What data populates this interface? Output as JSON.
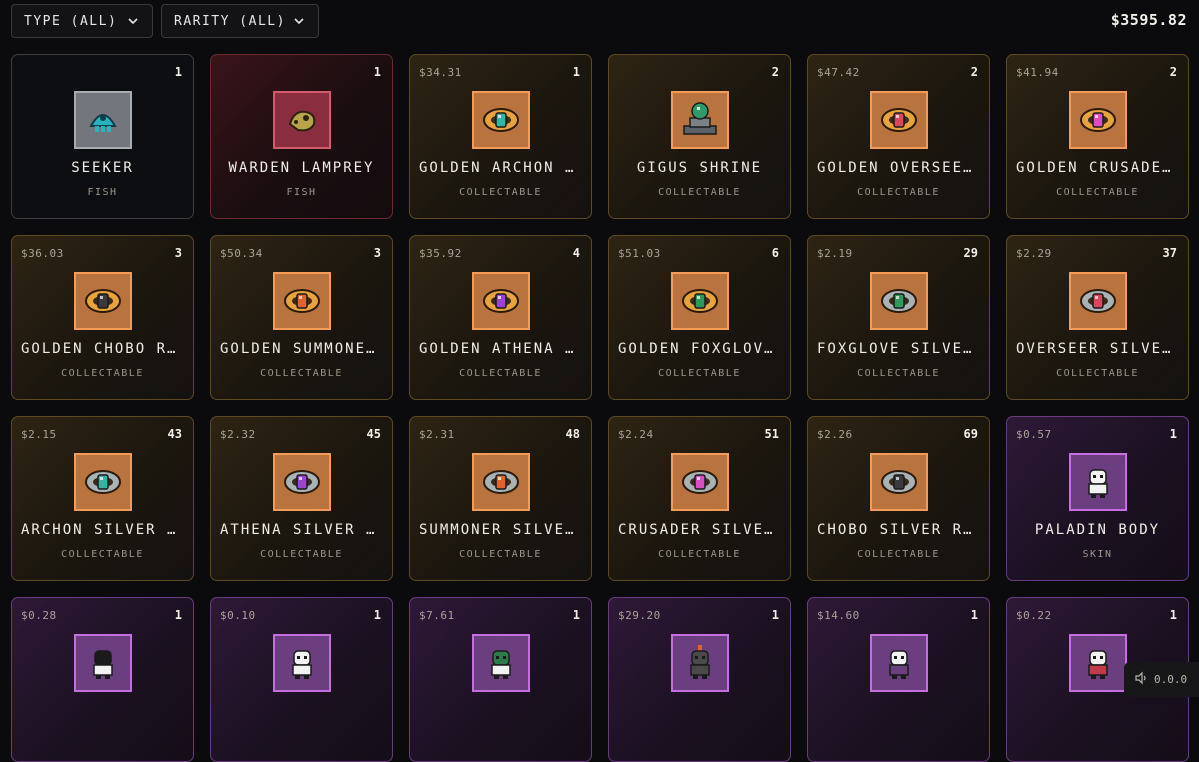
{
  "filters": {
    "type_label": "TYPE (ALL)",
    "rarity_label": "RARITY (ALL)"
  },
  "balance": "$3595.82",
  "footer": {
    "volume_text": "0.0.0"
  },
  "colors": {
    "background": "#0b0b0d",
    "fish_border": "#3c3d42",
    "gold_card": "#2e2413",
    "skin_card": "#2f1838",
    "orange_frame": "#f39b57",
    "purple_frame": "#c46ee0"
  },
  "items": [
    {
      "price": "",
      "qty": "1",
      "name": "SEEKER",
      "type": "FISH",
      "card": "fish",
      "frame": "common",
      "icon": "seeker-fish-icon"
    },
    {
      "price": "",
      "qty": "1",
      "name": "WARDEN LAMPREY",
      "type": "FISH",
      "card": "fish red",
      "frame": "red",
      "icon": "lamprey-fish-icon"
    },
    {
      "price": "$34.31",
      "qty": "1",
      "name": "GOLDEN ARCHON R…",
      "type": "COLLECTABLE",
      "card": "gold",
      "frame": "orange",
      "icon": "golden-ring-icon",
      "gem": "#2fb7a6",
      "band": "#e8a33c"
    },
    {
      "price": "",
      "qty": "2",
      "name": "GIGUS SHRINE",
      "type": "COLLECTABLE",
      "card": "gold",
      "frame": "orange",
      "icon": "shrine-icon"
    },
    {
      "price": "$47.42",
      "qty": "2",
      "name": "GOLDEN OVERSEER…",
      "type": "COLLECTABLE",
      "card": "gold",
      "frame": "orange",
      "icon": "golden-ring-icon",
      "gem": "#d8475a",
      "band": "#e8a33c"
    },
    {
      "price": "$41.94",
      "qty": "2",
      "name": "GOLDEN CRUSADER…",
      "type": "COLLECTABLE",
      "card": "gold",
      "frame": "orange",
      "icon": "golden-ring-icon",
      "gem": "#d94fc1",
      "band": "#e8a33c"
    },
    {
      "price": "$36.03",
      "qty": "3",
      "name": "GOLDEN CHOBO RI…",
      "type": "COLLECTABLE",
      "card": "gold",
      "frame": "orange",
      "icon": "golden-ring-icon",
      "gem": "#3a3a3e",
      "band": "#e8a33c"
    },
    {
      "price": "$50.34",
      "qty": "3",
      "name": "GOLDEN SUMMONER…",
      "type": "COLLECTABLE",
      "card": "gold",
      "frame": "orange",
      "icon": "golden-ring-icon",
      "gem": "#e0622c",
      "band": "#e8a33c"
    },
    {
      "price": "$35.92",
      "qty": "4",
      "name": "GOLDEN ATHENA R…",
      "type": "COLLECTABLE",
      "card": "gold",
      "frame": "orange",
      "icon": "golden-ring-icon",
      "gem": "#9a43d6",
      "band": "#e8a33c"
    },
    {
      "price": "$51.03",
      "qty": "6",
      "name": "GOLDEN FOXGLOVE…",
      "type": "COLLECTABLE",
      "card": "gold",
      "frame": "orange",
      "icon": "golden-ring-icon",
      "gem": "#2e9a5a",
      "band": "#e8a33c"
    },
    {
      "price": "$2.19",
      "qty": "29",
      "name": "FOXGLOVE SILVER…",
      "type": "COLLECTABLE",
      "card": "gold",
      "frame": "orange",
      "icon": "silver-ring-icon",
      "gem": "#2e9a5a",
      "band": "#a9b3b6"
    },
    {
      "price": "$2.29",
      "qty": "37",
      "name": "OVERSEER SILVER…",
      "type": "COLLECTABLE",
      "card": "gold",
      "frame": "orange",
      "icon": "silver-ring-icon",
      "gem": "#d8475a",
      "band": "#a9b3b6"
    },
    {
      "price": "$2.15",
      "qty": "43",
      "name": "ARCHON SILVER R…",
      "type": "COLLECTABLE",
      "card": "gold",
      "frame": "orange",
      "icon": "silver-ring-icon",
      "gem": "#2fb7a6",
      "band": "#a9b3b6"
    },
    {
      "price": "$2.32",
      "qty": "45",
      "name": "ATHENA SILVER R…",
      "type": "COLLECTABLE",
      "card": "gold",
      "frame": "orange",
      "icon": "silver-ring-icon",
      "gem": "#9a43d6",
      "band": "#a9b3b6"
    },
    {
      "price": "$2.31",
      "qty": "48",
      "name": "SUMMONER SILVER…",
      "type": "COLLECTABLE",
      "card": "gold",
      "frame": "orange",
      "icon": "silver-ring-icon",
      "gem": "#e0622c",
      "band": "#a9b3b6"
    },
    {
      "price": "$2.24",
      "qty": "51",
      "name": "CRUSADER SILVER…",
      "type": "COLLECTABLE",
      "card": "gold",
      "frame": "orange",
      "icon": "silver-ring-icon",
      "gem": "#d94fc1",
      "band": "#a9b3b6"
    },
    {
      "price": "$2.26",
      "qty": "69",
      "name": "CHOBO SILVER RI…",
      "type": "COLLECTABLE",
      "card": "gold",
      "frame": "orange",
      "icon": "silver-ring-icon",
      "gem": "#3a3a3e",
      "band": "#a9b3b6"
    },
    {
      "price": "$0.57",
      "qty": "1",
      "name": "PALADIN BODY",
      "type": "SKIN",
      "card": "skin",
      "frame": "purple",
      "icon": "skin-figure-icon",
      "head": "#f2f2f2",
      "body": "#f2f2f2"
    },
    {
      "price": "$0.28",
      "qty": "1",
      "name": "",
      "type": "",
      "card": "skin",
      "frame": "purple",
      "icon": "skin-figure-icon",
      "head": "#1a1a1a",
      "body": "#f2f2f2"
    },
    {
      "price": "$0.10",
      "qty": "1",
      "name": "",
      "type": "",
      "card": "skin",
      "frame": "purple",
      "icon": "skin-figure-icon",
      "head": "#f2f2f2",
      "body": "#f2f2f2"
    },
    {
      "price": "$7.61",
      "qty": "1",
      "name": "",
      "type": "",
      "card": "skin",
      "frame": "purple",
      "icon": "skin-figure-icon",
      "head": "#2d7a4a",
      "body": "#f2f2f2"
    },
    {
      "price": "$29.20",
      "qty": "1",
      "name": "",
      "type": "",
      "card": "skin",
      "frame": "purple",
      "icon": "skin-figure-icon",
      "head": "#4a4a4a",
      "body": "#4a4a4a",
      "crest": "#e0622c"
    },
    {
      "price": "$14.60",
      "qty": "1",
      "name": "",
      "type": "",
      "card": "skin",
      "frame": "purple",
      "icon": "skin-figure-icon",
      "head": "#f2f2f2",
      "body": "#6b3e80"
    },
    {
      "price": "$0.22",
      "qty": "1",
      "name": "",
      "type": "",
      "card": "skin",
      "frame": "purple",
      "icon": "skin-figure-icon",
      "head": "#f2f2f2",
      "body": "#c43a4a"
    }
  ]
}
